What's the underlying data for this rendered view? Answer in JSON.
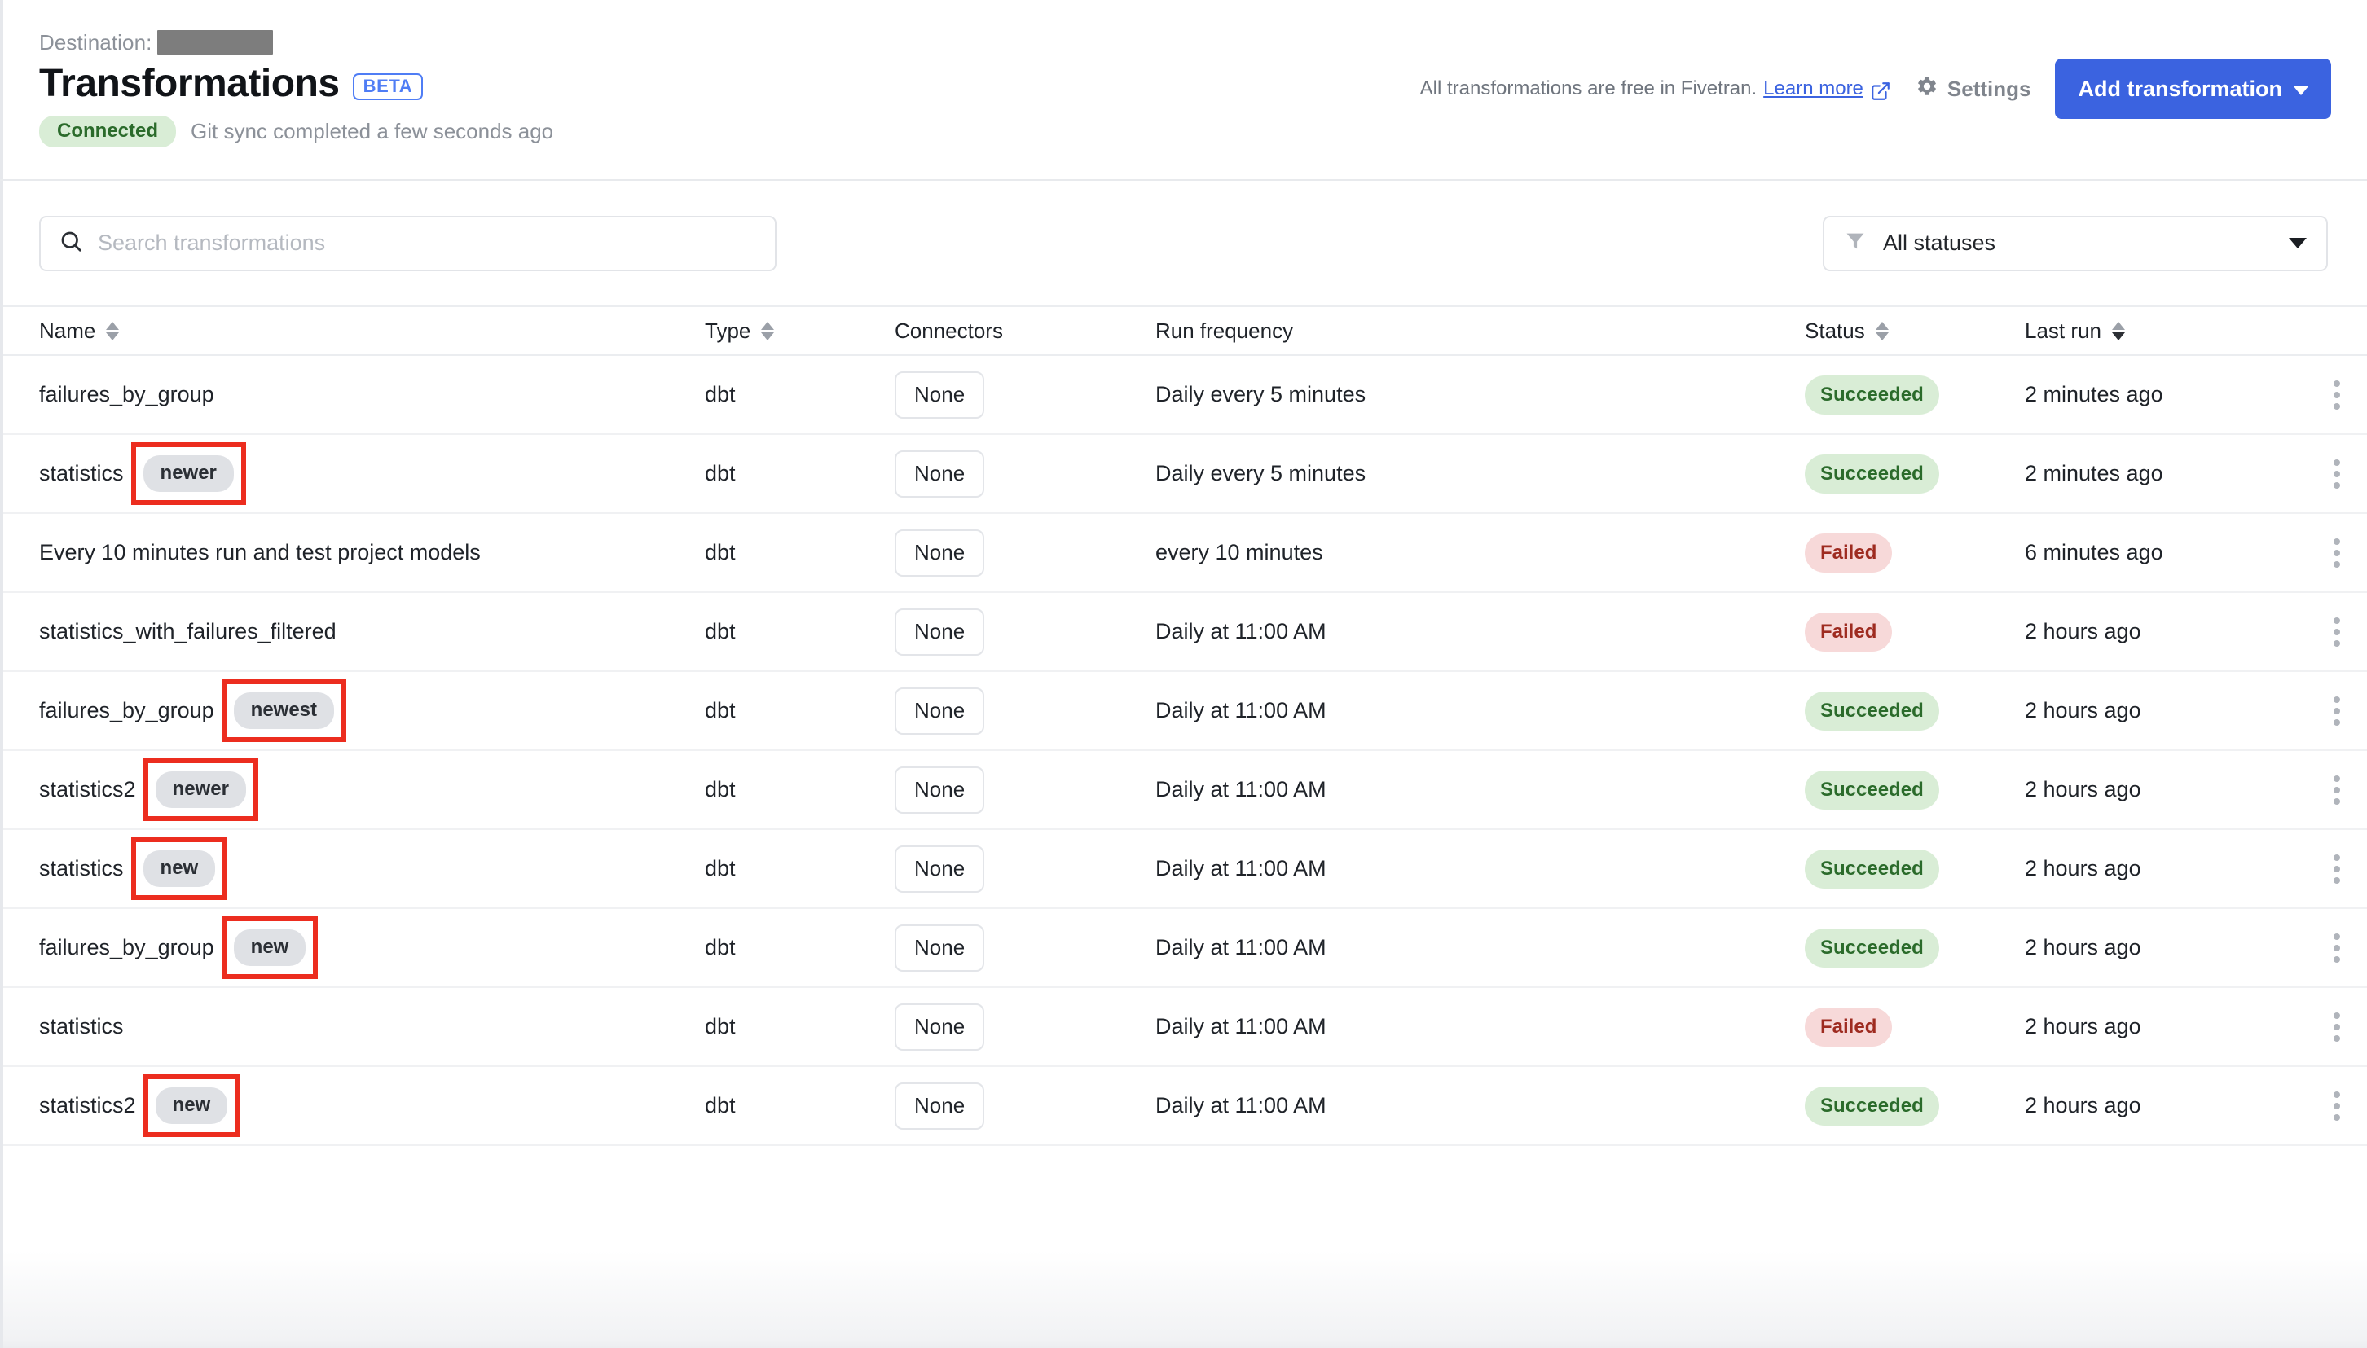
{
  "header": {
    "destination_label": "Destination:",
    "destination_value_redacted": true,
    "title": "Transformations",
    "beta_badge": "BETA",
    "connection_status": "Connected",
    "sync_message": "Git sync completed a few seconds ago",
    "free_note_text": "All transformations are free in Fivetran.",
    "learn_more_label": "Learn more",
    "settings_label": "Settings",
    "add_transformation_label": "Add transformation"
  },
  "toolbar": {
    "search_placeholder": "Search transformations",
    "search_value": "",
    "status_filter_selected": "All statuses"
  },
  "table": {
    "columns": [
      {
        "label": "Name",
        "sortable": true,
        "sort_state": "none"
      },
      {
        "label": "Type",
        "sortable": true,
        "sort_state": "none"
      },
      {
        "label": "Connectors",
        "sortable": false,
        "sort_state": "none"
      },
      {
        "label": "Run frequency",
        "sortable": false,
        "sort_state": "none"
      },
      {
        "label": "Status",
        "sortable": true,
        "sort_state": "none"
      },
      {
        "label": "Last run",
        "sortable": true,
        "sort_state": "desc"
      }
    ],
    "rows": [
      {
        "name": "failures_by_group",
        "badge": null,
        "annotated": false,
        "type": "dbt",
        "connectors": "None",
        "run_frequency": "Daily every 5 minutes",
        "status": "Succeeded",
        "status_kind": "succeeded",
        "last_run": "2 minutes ago"
      },
      {
        "name": "statistics",
        "badge": "newer",
        "annotated": true,
        "type": "dbt",
        "connectors": "None",
        "run_frequency": "Daily every 5 minutes",
        "status": "Succeeded",
        "status_kind": "succeeded",
        "last_run": "2 minutes ago"
      },
      {
        "name": "Every 10 minutes run and test project models",
        "badge": null,
        "annotated": false,
        "type": "dbt",
        "connectors": "None",
        "run_frequency": "every 10 minutes",
        "status": "Failed",
        "status_kind": "failed",
        "last_run": "6 minutes ago"
      },
      {
        "name": "statistics_with_failures_filtered",
        "badge": null,
        "annotated": false,
        "type": "dbt",
        "connectors": "None",
        "run_frequency": "Daily at 11:00 AM",
        "status": "Failed",
        "status_kind": "failed",
        "last_run": "2 hours ago"
      },
      {
        "name": "failures_by_group",
        "badge": "newest",
        "annotated": true,
        "type": "dbt",
        "connectors": "None",
        "run_frequency": "Daily at 11:00 AM",
        "status": "Succeeded",
        "status_kind": "succeeded",
        "last_run": "2 hours ago"
      },
      {
        "name": "statistics2",
        "badge": "newer",
        "annotated": true,
        "type": "dbt",
        "connectors": "None",
        "run_frequency": "Daily at 11:00 AM",
        "status": "Succeeded",
        "status_kind": "succeeded",
        "last_run": "2 hours ago"
      },
      {
        "name": "statistics",
        "badge": "new",
        "annotated": true,
        "type": "dbt",
        "connectors": "None",
        "run_frequency": "Daily at 11:00 AM",
        "status": "Succeeded",
        "status_kind": "succeeded",
        "last_run": "2 hours ago"
      },
      {
        "name": "failures_by_group",
        "badge": "new",
        "annotated": true,
        "type": "dbt",
        "connectors": "None",
        "run_frequency": "Daily at 11:00 AM",
        "status": "Succeeded",
        "status_kind": "succeeded",
        "last_run": "2 hours ago"
      },
      {
        "name": "statistics",
        "badge": null,
        "annotated": false,
        "type": "dbt",
        "connectors": "None",
        "run_frequency": "Daily at 11:00 AM",
        "status": "Failed",
        "status_kind": "failed",
        "last_run": "2 hours ago"
      },
      {
        "name": "statistics2",
        "badge": "new",
        "annotated": true,
        "type": "dbt",
        "connectors": "None",
        "run_frequency": "Daily at 11:00 AM",
        "status": "Succeeded",
        "status_kind": "succeeded",
        "last_run": "2 hours ago"
      }
    ]
  },
  "colors": {
    "brand_blue": "#3b63e0",
    "link_blue": "#3b63e0",
    "beta_blue": "#4f7df5",
    "success_bg": "#d9edd6",
    "success_fg": "#2b6b2b",
    "failed_bg": "#f7d9d9",
    "failed_fg": "#9e2b20",
    "badge_bg": "#dfe1e5",
    "annotation_red": "#ec2d1f",
    "redaction_gray": "#7d7d7d"
  },
  "icons": {
    "search": "search-icon",
    "gear": "gear-icon",
    "filter": "filter-icon",
    "external_link": "external-link-icon",
    "kebab": "kebab-menu-icon"
  }
}
